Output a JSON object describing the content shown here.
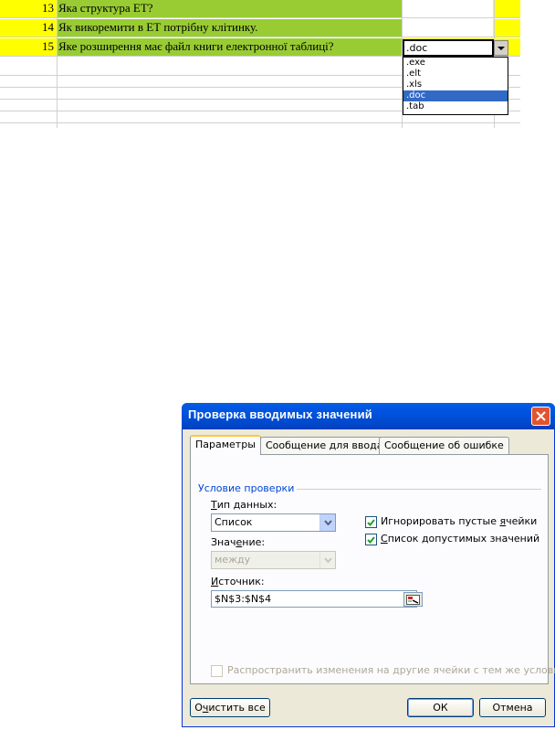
{
  "sheet": {
    "rows": [
      {
        "num": "13",
        "text": "Яка структура ЕТ?"
      },
      {
        "num": "14",
        "text": "Як викоремити в ЕТ потрібну клітинку."
      },
      {
        "num": "15",
        "text": "Яке розширення має файл книги електронної таблиці?"
      }
    ],
    "cell_value": ".doc",
    "dropdown_options": [
      ".exe",
      ".elt",
      ".xls",
      ".doc",
      ".tab"
    ],
    "dropdown_selected": ".doc",
    "colors": {
      "row_highlight": "#ffff00",
      "question_fill": "#99cc33",
      "selection": "#316ac5"
    }
  },
  "dialog": {
    "title": "Проверка вводимых значений",
    "tabs": [
      "Параметры",
      "Сообщение для ввода",
      "Сообщение об ошибке"
    ],
    "active_tab": "Параметры",
    "group_label": "Условие проверки",
    "type_label_u": "Т",
    "type_label_rest": "ип данных:",
    "type_value": "Список",
    "value_label_pre": "Знач",
    "value_label_u": "е",
    "value_label_post": "ние:",
    "value_value": "между",
    "source_label_u": "И",
    "source_label_rest": "сточник:",
    "source_value": "$N$3:$N$4",
    "ignore_blank_pre": "Игнорировать пустые ",
    "ignore_blank_u": "я",
    "ignore_blank_post": "чейки",
    "ignore_blank_checked": true,
    "in_cell_u": "С",
    "in_cell_rest": "писок допустимых значений",
    "in_cell_checked": true,
    "apply_all": "Распространить изменения на другие ячейки с тем же условием",
    "apply_all_checked": false,
    "clear_pre": "О",
    "clear_u": "ч",
    "clear_post": "истить все",
    "ok": "ОК",
    "cancel": "Отмена"
  }
}
